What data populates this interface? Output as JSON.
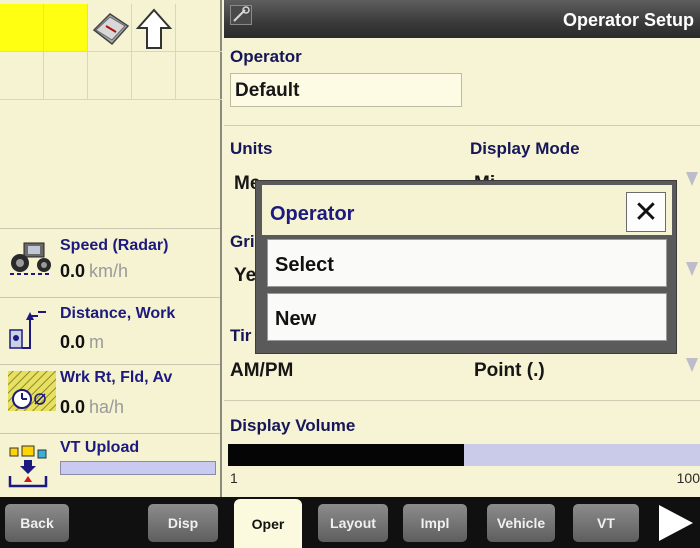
{
  "left_panel": {
    "speed": {
      "label": "Speed (Radar)",
      "value": "0.0",
      "unit": "km/h",
      "icon": "tractor-icon"
    },
    "distance": {
      "label": "Distance, Work",
      "value": "0.0",
      "unit": "m",
      "icon": "distance-icon"
    },
    "work_rate": {
      "label": "Wrk Rt, Fld, Av",
      "value": "0.0",
      "unit": "ha/h",
      "icon": "work-rate-icon"
    },
    "vt_upload": {
      "label": "VT Upload",
      "icon": "vt-upload-icon"
    }
  },
  "header": {
    "title": "Operator Setup",
    "icon": "settings-icon"
  },
  "form": {
    "operator_label": "Operator",
    "operator_value": "Default",
    "units_label": "Units",
    "units_value": "Me",
    "display_mode_label": "Display Mode",
    "display_mode_value": "Mi",
    "grid_label": "Gri",
    "grid_value": "Ye",
    "time_label": "Tir",
    "time_value": "AM/PM",
    "decimal_value": "Point (.)",
    "display_volume_label": "Display Volume",
    "volume_level": 0.5,
    "volume_min": "1",
    "volume_max": "100"
  },
  "modal": {
    "title": "Operator",
    "close_icon": "close-icon",
    "options": [
      "Select",
      "New"
    ]
  },
  "bottom_tabs": {
    "back": "Back",
    "disp": "Disp",
    "oper": "Oper",
    "layout": "Layout",
    "impl": "Impl",
    "vehicle": "Vehicle",
    "vt": "VT",
    "next_icon": "next-arrow-icon"
  },
  "colors": {
    "accent_yellow": "#ffff12",
    "label_blue": "#1c1a7e",
    "panel_bg": "#f5f3d2"
  }
}
